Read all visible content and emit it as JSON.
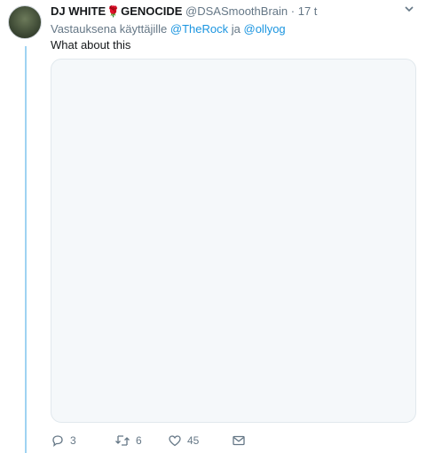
{
  "tweet": {
    "author_name": "DJ WHITE",
    "author_name_suffix": "GENOCIDE",
    "emoji": "🌹",
    "handle": "@DSASmoothBrain",
    "separator": "·",
    "time": "17 t",
    "reply_prefix": "Vastauksena käyttäjille",
    "reply_mention_1": "@TheRock",
    "reply_joiner": "ja",
    "reply_mention_2": "@ollyog",
    "text": "What about this"
  },
  "actions": {
    "reply_count": "3",
    "retweet_count": "6",
    "like_count": "45"
  },
  "icons": [
    "chevron-down-icon",
    "reply-icon",
    "retweet-icon",
    "like-icon",
    "message-icon"
  ],
  "colors": {
    "thread_line": "#9fd3f2",
    "link": "#1b95e0",
    "muted": "#657786"
  }
}
